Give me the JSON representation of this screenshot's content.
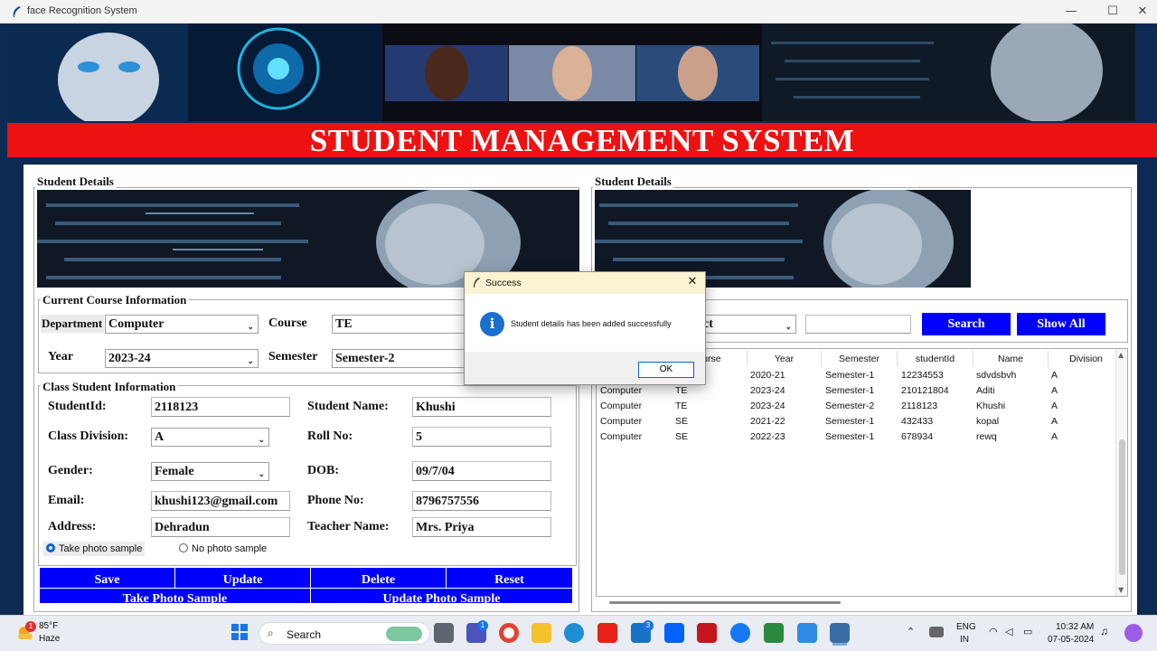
{
  "window": {
    "title": "face Recognition System",
    "minimize": "—",
    "maximize": "☐",
    "close": "✕"
  },
  "header": {
    "title": "STUDENT MANAGEMENT SYSTEM"
  },
  "left_panel": {
    "legend": "Student Details",
    "course_info": {
      "legend": "Current Course Information",
      "department_label": "Department",
      "department_value": "Computer",
      "course_label": "Course",
      "course_value": "TE",
      "year_label": "Year",
      "year_value": "2023-24",
      "semester_label": "Semester",
      "semester_value": "Semester-2"
    },
    "class_info": {
      "legend": "Class Student Information",
      "student_id_label": "StudentId:",
      "student_id_value": "2118123",
      "student_name_label": "Student Name:",
      "student_name_value": "Khushi",
      "division_label": "Class Division:",
      "division_value": "A",
      "roll_label": "Roll No:",
      "roll_value": "5",
      "gender_label": "Gender:",
      "gender_value": "Female",
      "dob_label": "DOB:",
      "dob_value": "09/7/04",
      "email_label": "Email:",
      "email_value": "khushi123@gmail.com",
      "phone_label": "Phone No:",
      "phone_value": "8796757556",
      "address_label": "Address:",
      "address_value": "Dehradun",
      "teacher_label": "Teacher Name:",
      "teacher_value": "Mrs. Priya",
      "radio_take": "Take photo sample",
      "radio_no": "No photo sample"
    },
    "buttons": {
      "save": "Save",
      "update": "Update",
      "delete": "Delete",
      "reset": "Reset",
      "take_photo": "Take Photo Sample",
      "update_photo": "Update Photo Sample"
    }
  },
  "right_panel": {
    "legend": "Student Details",
    "search": {
      "select_value": "ct",
      "input_value": "",
      "search_btn": "Search",
      "show_all_btn": "Show All"
    },
    "table": {
      "headers": [
        "ourse",
        "Year",
        "Semester",
        "studentId",
        "Name",
        "Division"
      ],
      "rows": [
        [
          "",
          "",
          "2020-21",
          "Semester-1",
          "12234553",
          "sdvdsbvh",
          "A"
        ],
        [
          "Computer",
          "TE",
          "2023-24",
          "Semester-1",
          "210121804",
          "Aditi",
          "A"
        ],
        [
          "Computer",
          "TE",
          "2023-24",
          "Semester-2",
          "2118123",
          "Khushi",
          "A"
        ],
        [
          "Computer",
          "SE",
          "2021-22",
          "Semester-1",
          "432433",
          "kopal",
          "A"
        ],
        [
          "Computer",
          "SE",
          "2022-23",
          "Semester-1",
          "678934",
          "rewq",
          "A"
        ]
      ]
    }
  },
  "dialog": {
    "title": "Success",
    "message": "Student details has been added successfully",
    "ok": "OK",
    "close": "✕",
    "icon": "i"
  },
  "taskbar": {
    "weather_temp": "85°F",
    "weather_desc": "Haze",
    "weather_badge": "1",
    "search_label": "Search",
    "lang_top": "ENG",
    "lang_bottom": "IN",
    "time": "10:32 AM",
    "date": "07-05-2024",
    "badge_teams": "1",
    "badge_mail": "3"
  }
}
